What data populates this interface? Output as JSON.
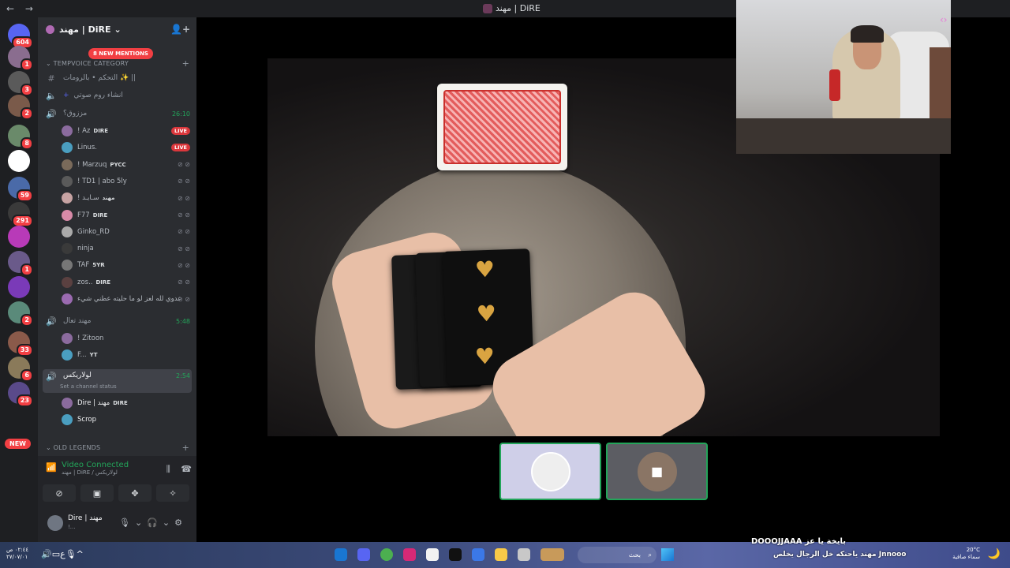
{
  "window": {
    "title": "مهند | DiRE",
    "nav_back": "←",
    "nav_forward": "→"
  },
  "servers": {
    "icons": [
      {
        "name": "discord-home-icon",
        "badge": "604",
        "color": "#5865f2"
      },
      {
        "name": "server-1",
        "badge": "1",
        "color": "#8a6d8f"
      },
      {
        "name": "server-2",
        "badge": "3",
        "color": "#5a5a5a"
      },
      {
        "name": "server-3",
        "badge": "2",
        "color": "#7a5a4a"
      },
      {
        "name": "server-4",
        "badge": "8",
        "color": "#6a8a6a"
      },
      {
        "name": "server-5",
        "badge": "",
        "color": "#ffffff"
      },
      {
        "name": "server-6",
        "badge": "59",
        "color": "#4a6aa8"
      },
      {
        "name": "server-7",
        "badge": "291",
        "color": "#3a3a3a"
      },
      {
        "name": "server-8",
        "badge": "",
        "color": "#b83ab8"
      },
      {
        "name": "server-9",
        "badge": "1",
        "color": "#6a5a8a"
      },
      {
        "name": "server-10",
        "badge": "",
        "color": "#7a3ab8"
      },
      {
        "name": "server-11",
        "badge": "2",
        "color": "#5a8a7a"
      },
      {
        "name": "server-12",
        "badge": "33",
        "color": "#8a5a4a"
      },
      {
        "name": "server-13",
        "badge": "6",
        "color": "#8a7a5a"
      },
      {
        "name": "server-14",
        "badge": "23",
        "color": "#5a4a8a"
      }
    ],
    "new_label": "NEW"
  },
  "guild": {
    "name": "مهند | DiRE",
    "new_mentions": "8 NEW MENTIONS"
  },
  "categories": {
    "tempvoice": "TEMPVOICE CATEGORY",
    "old_legends": "OLD LEGENDS"
  },
  "channels": {
    "control": "التحكم • بالرومات ✨ ||",
    "create_voice": "انشاء روم صوتي",
    "voice1": {
      "name": "مززوق؟",
      "timer": "26:10"
    },
    "voice2": {
      "name": "مهند تعال",
      "timer": "5:48"
    },
    "voice3": {
      "name": "لولاريكس",
      "timer": "2:54",
      "status": "Set a channel status"
    }
  },
  "voice1_users": [
    {
      "name": "! Az",
      "tag": "DIRE",
      "live": "LIVE"
    },
    {
      "name": "Linus.",
      "tag": "",
      "live": "LIVE"
    },
    {
      "name": "! Marzuq",
      "tag": "PYCC",
      "live": ""
    },
    {
      "name": "! TD1 | abo 5ly",
      "tag": "",
      "live": ""
    },
    {
      "name": "! سـايـد",
      "tag": "مهند",
      "live": ""
    },
    {
      "name": "F77",
      "tag": "DIRE",
      "live": ""
    },
    {
      "name": "Ginko_RD",
      "tag": "",
      "live": ""
    },
    {
      "name": "ninja",
      "tag": "",
      "live": ""
    },
    {
      "name": "TAF",
      "tag": "5YR",
      "live": ""
    },
    {
      "name": "zos..",
      "tag": "DIRE",
      "live": ""
    },
    {
      "name": "عدوي لله لعز لو ما حليته عطني شيء",
      "tag": "",
      "live": ""
    }
  ],
  "voice2_users": [
    {
      "name": "! Zitoon",
      "tag": ""
    },
    {
      "name": "F...",
      "tag": "YT"
    }
  ],
  "voice3_users": [
    {
      "name": "Dire | مهند",
      "tag": "DIRE"
    },
    {
      "name": "Scrop",
      "tag": ""
    }
  ],
  "voice_panel": {
    "title": "Video Connected",
    "subtitle": "مهند | DiRE / لولاريكس"
  },
  "user_panel": {
    "name": "Dire | مهند",
    "status": "!..."
  },
  "taskbar": {
    "time": "٠٢:٤٤ ص",
    "date": "٢٧/٠٧/٠١",
    "lang": "ع",
    "search_placeholder": "بحث",
    "temperature": "20°C",
    "weather": "سماء صافية"
  },
  "chat_overlay": {
    "line1": "DOOOJJAAA بايخة يا عز",
    "line2": "مهند ياحنكه خل الرجال يخلص Jnnooo"
  }
}
